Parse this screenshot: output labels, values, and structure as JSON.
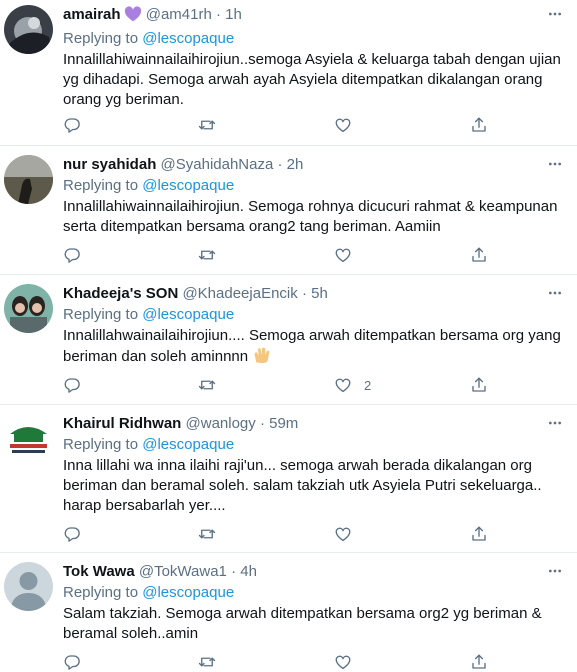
{
  "colors": {
    "link": "#1b95e0",
    "secondary": "#5b7083",
    "text": "#0f1419",
    "divider": "#e6ecf0"
  },
  "icons": [
    "more-icon",
    "reply-icon",
    "retweet-icon",
    "like-icon",
    "share-icon",
    "purple-heart-emoji",
    "clapping-hands-emoji"
  ],
  "reply_prefix": "Replying to",
  "tweets": [
    {
      "name": "amairah",
      "handle": "@am41rh",
      "dot": "·",
      "time": "1h",
      "replying_to": "@lescopaque",
      "text": "Innalillahiwainnailaihirojiun..semoga Asyiela & keluarga tabah dengan ujian yg dihadapi. Semoga arwah ayah Asyiela ditempatkan dikalangan orang orang yg beriman.",
      "likes": ""
    },
    {
      "name": "nur syahidah",
      "handle": "@SyahidahNaza",
      "dot": "·",
      "time": "2h",
      "replying_to": "@lescopaque",
      "text": "Innalillahiwainnailaihirojiun.  Semoga rohnya dicucuri rahmat & keampunan serta ditempatkan bersama orang2 tang beriman. Aamiin",
      "likes": ""
    },
    {
      "name": "Khadeeja's SON",
      "handle": "@KhadeejaEncik",
      "dot": "·",
      "time": "5h",
      "replying_to": "@lescopaque",
      "text": "Innalillahwainailaihirojiun.... Semoga arwah ditempatkan bersama org yang beriman dan soleh aminnnn",
      "likes": "2"
    },
    {
      "name": "Khairul Ridhwan",
      "handle": "@wanlogy",
      "dot": "·",
      "time": "59m",
      "replying_to": "@lescopaque",
      "text": "Inna lillahi wa inna ilaihi raji'un... semoga arwah berada dikalangan org beriman dan beramal soleh. salam takziah utk Asyiela Putri sekeluarga.. harap bersabarlah yer....",
      "likes": ""
    },
    {
      "name": "Tok Wawa",
      "handle": "@TokWawa1",
      "dot": "·",
      "time": "4h",
      "replying_to": "@lescopaque",
      "text": "Salam takziah. Semoga arwah ditempatkan bersama org2 yg beriman & beramal soleh..amin",
      "likes": ""
    }
  ]
}
